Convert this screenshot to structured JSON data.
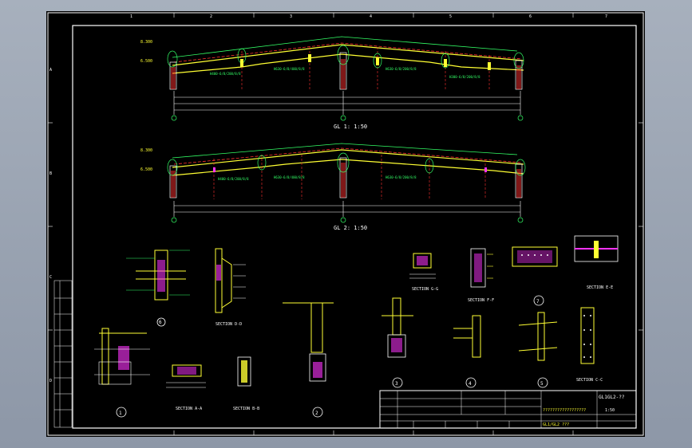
{
  "canvas": {
    "background": "#000000",
    "viewport_bg": "#9aa3b1"
  },
  "colors": {
    "frame": "#ffffff",
    "beam": "#ffff33",
    "dim": "#33ff66",
    "axis": "#ff3030",
    "purlin": "#ff33ff",
    "text": "#ffffff",
    "annot": "#00ffff"
  },
  "grid": {
    "columns": [
      "1",
      "2",
      "3",
      "4",
      "5",
      "6",
      "7"
    ],
    "rows": [
      "A",
      "B",
      "C",
      "D"
    ]
  },
  "elevations": {
    "e1": {
      "left_top": "8.300",
      "left_bot": "6.500",
      "title": "GL 1: 1:50"
    },
    "e2": {
      "left_top": "8.300",
      "left_bot": "6.500",
      "title": "GL 2: 1:50"
    }
  },
  "details": {
    "d6": "6",
    "sec_dd": "SECTION D-D",
    "sec_gg": "SECTION G-G",
    "sec_ff": "SECTION F-F",
    "d7": "7",
    "sec_ee": "SECTION E-E",
    "d1": "1",
    "sec_aa": "SECTION A-A",
    "sec_bb": "SECTION B-B",
    "d2": "2",
    "d3": "3",
    "d4": "4",
    "d5": "5",
    "sec_cc": "SECTION C-C"
  },
  "title_block": {
    "drawing_no": "GL1GL2-??",
    "project": "??????????????????",
    "scale": "1:50",
    "sheet_code": "GL1/GL2 ???"
  }
}
